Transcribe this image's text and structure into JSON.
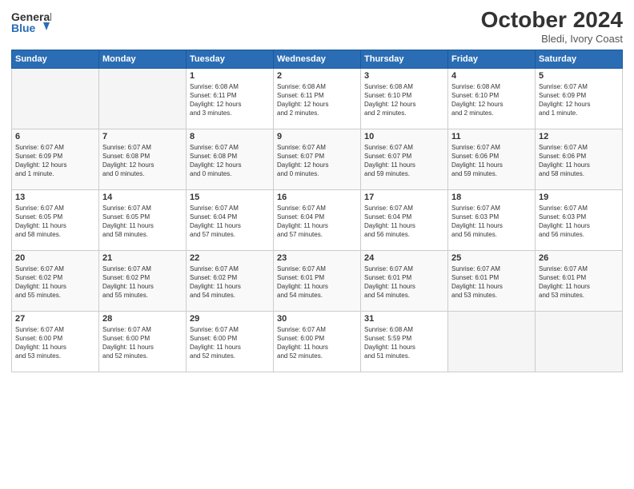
{
  "header": {
    "logo_line1": "General",
    "logo_line2": "Blue",
    "month": "October 2024",
    "location": "Bledi, Ivory Coast"
  },
  "weekdays": [
    "Sunday",
    "Monday",
    "Tuesday",
    "Wednesday",
    "Thursday",
    "Friday",
    "Saturday"
  ],
  "weeks": [
    [
      {
        "day": "",
        "info": ""
      },
      {
        "day": "",
        "info": ""
      },
      {
        "day": "1",
        "info": "Sunrise: 6:08 AM\nSunset: 6:11 PM\nDaylight: 12 hours\nand 3 minutes."
      },
      {
        "day": "2",
        "info": "Sunrise: 6:08 AM\nSunset: 6:11 PM\nDaylight: 12 hours\nand 2 minutes."
      },
      {
        "day": "3",
        "info": "Sunrise: 6:08 AM\nSunset: 6:10 PM\nDaylight: 12 hours\nand 2 minutes."
      },
      {
        "day": "4",
        "info": "Sunrise: 6:08 AM\nSunset: 6:10 PM\nDaylight: 12 hours\nand 2 minutes."
      },
      {
        "day": "5",
        "info": "Sunrise: 6:07 AM\nSunset: 6:09 PM\nDaylight: 12 hours\nand 1 minute."
      }
    ],
    [
      {
        "day": "6",
        "info": "Sunrise: 6:07 AM\nSunset: 6:09 PM\nDaylight: 12 hours\nand 1 minute."
      },
      {
        "day": "7",
        "info": "Sunrise: 6:07 AM\nSunset: 6:08 PM\nDaylight: 12 hours\nand 0 minutes."
      },
      {
        "day": "8",
        "info": "Sunrise: 6:07 AM\nSunset: 6:08 PM\nDaylight: 12 hours\nand 0 minutes."
      },
      {
        "day": "9",
        "info": "Sunrise: 6:07 AM\nSunset: 6:07 PM\nDaylight: 12 hours\nand 0 minutes."
      },
      {
        "day": "10",
        "info": "Sunrise: 6:07 AM\nSunset: 6:07 PM\nDaylight: 11 hours\nand 59 minutes."
      },
      {
        "day": "11",
        "info": "Sunrise: 6:07 AM\nSunset: 6:06 PM\nDaylight: 11 hours\nand 59 minutes."
      },
      {
        "day": "12",
        "info": "Sunrise: 6:07 AM\nSunset: 6:06 PM\nDaylight: 11 hours\nand 58 minutes."
      }
    ],
    [
      {
        "day": "13",
        "info": "Sunrise: 6:07 AM\nSunset: 6:05 PM\nDaylight: 11 hours\nand 58 minutes."
      },
      {
        "day": "14",
        "info": "Sunrise: 6:07 AM\nSunset: 6:05 PM\nDaylight: 11 hours\nand 58 minutes."
      },
      {
        "day": "15",
        "info": "Sunrise: 6:07 AM\nSunset: 6:04 PM\nDaylight: 11 hours\nand 57 minutes."
      },
      {
        "day": "16",
        "info": "Sunrise: 6:07 AM\nSunset: 6:04 PM\nDaylight: 11 hours\nand 57 minutes."
      },
      {
        "day": "17",
        "info": "Sunrise: 6:07 AM\nSunset: 6:04 PM\nDaylight: 11 hours\nand 56 minutes."
      },
      {
        "day": "18",
        "info": "Sunrise: 6:07 AM\nSunset: 6:03 PM\nDaylight: 11 hours\nand 56 minutes."
      },
      {
        "day": "19",
        "info": "Sunrise: 6:07 AM\nSunset: 6:03 PM\nDaylight: 11 hours\nand 56 minutes."
      }
    ],
    [
      {
        "day": "20",
        "info": "Sunrise: 6:07 AM\nSunset: 6:02 PM\nDaylight: 11 hours\nand 55 minutes."
      },
      {
        "day": "21",
        "info": "Sunrise: 6:07 AM\nSunset: 6:02 PM\nDaylight: 11 hours\nand 55 minutes."
      },
      {
        "day": "22",
        "info": "Sunrise: 6:07 AM\nSunset: 6:02 PM\nDaylight: 11 hours\nand 54 minutes."
      },
      {
        "day": "23",
        "info": "Sunrise: 6:07 AM\nSunset: 6:01 PM\nDaylight: 11 hours\nand 54 minutes."
      },
      {
        "day": "24",
        "info": "Sunrise: 6:07 AM\nSunset: 6:01 PM\nDaylight: 11 hours\nand 54 minutes."
      },
      {
        "day": "25",
        "info": "Sunrise: 6:07 AM\nSunset: 6:01 PM\nDaylight: 11 hours\nand 53 minutes."
      },
      {
        "day": "26",
        "info": "Sunrise: 6:07 AM\nSunset: 6:01 PM\nDaylight: 11 hours\nand 53 minutes."
      }
    ],
    [
      {
        "day": "27",
        "info": "Sunrise: 6:07 AM\nSunset: 6:00 PM\nDaylight: 11 hours\nand 53 minutes."
      },
      {
        "day": "28",
        "info": "Sunrise: 6:07 AM\nSunset: 6:00 PM\nDaylight: 11 hours\nand 52 minutes."
      },
      {
        "day": "29",
        "info": "Sunrise: 6:07 AM\nSunset: 6:00 PM\nDaylight: 11 hours\nand 52 minutes."
      },
      {
        "day": "30",
        "info": "Sunrise: 6:07 AM\nSunset: 6:00 PM\nDaylight: 11 hours\nand 52 minutes."
      },
      {
        "day": "31",
        "info": "Sunrise: 6:08 AM\nSunset: 5:59 PM\nDaylight: 11 hours\nand 51 minutes."
      },
      {
        "day": "",
        "info": ""
      },
      {
        "day": "",
        "info": ""
      }
    ]
  ]
}
